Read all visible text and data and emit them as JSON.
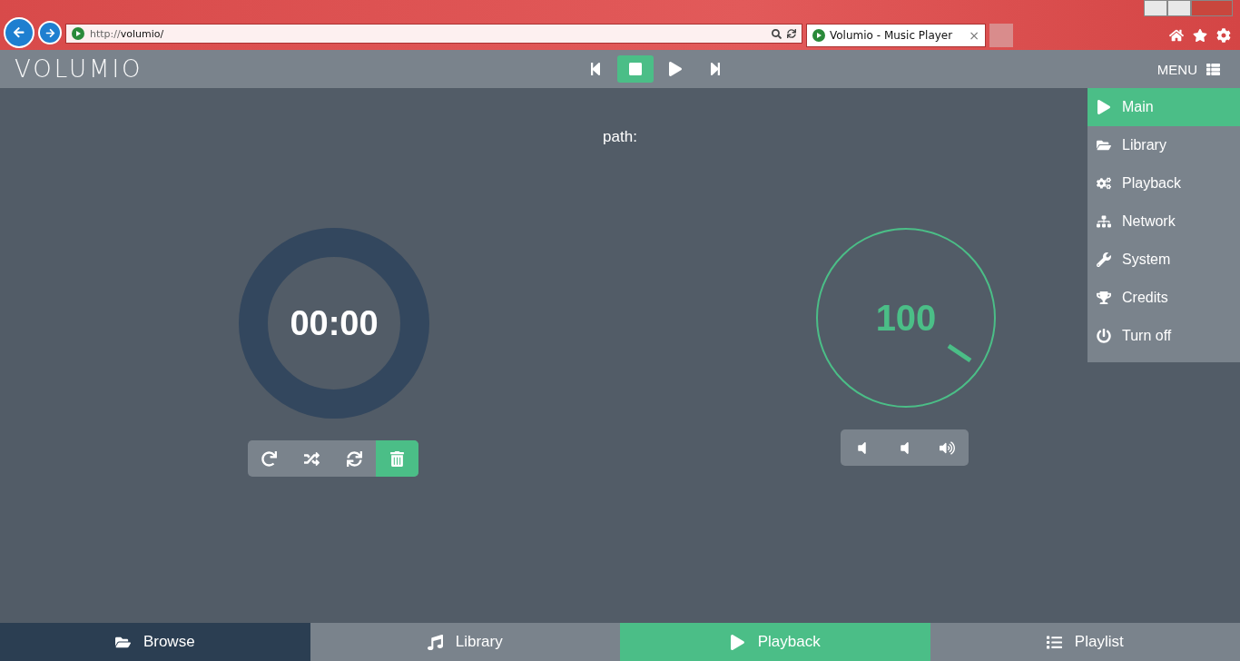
{
  "browser": {
    "url_scheme": "http://",
    "url_host": "volumio/",
    "tab_title": "Volumio - Music Player",
    "close_tab": "×"
  },
  "header": {
    "logo": "VOLUMIO",
    "menu_label": "MENU"
  },
  "transport": [
    {
      "selected": false
    },
    {
      "selected": true
    },
    {
      "selected": false
    },
    {
      "selected": false
    }
  ],
  "menu": [
    {
      "label": "Main",
      "selected": true
    },
    {
      "label": "Library",
      "selected": false
    },
    {
      "label": "Playback",
      "selected": false
    },
    {
      "label": "Network",
      "selected": false
    },
    {
      "label": "System",
      "selected": false
    },
    {
      "label": "Credits",
      "selected": false
    },
    {
      "label": "Turn off",
      "selected": false
    }
  ],
  "path_label": "path:",
  "time": "00:00",
  "volume": "100",
  "play_modes": [
    {
      "on": false
    },
    {
      "on": false
    },
    {
      "on": false
    },
    {
      "on": true
    }
  ],
  "bottom_tabs": [
    {
      "label": "Browse",
      "selected": false
    },
    {
      "label": "Library",
      "selected": false
    },
    {
      "label": "Playback",
      "selected": true
    },
    {
      "label": "Playlist",
      "selected": false
    }
  ]
}
